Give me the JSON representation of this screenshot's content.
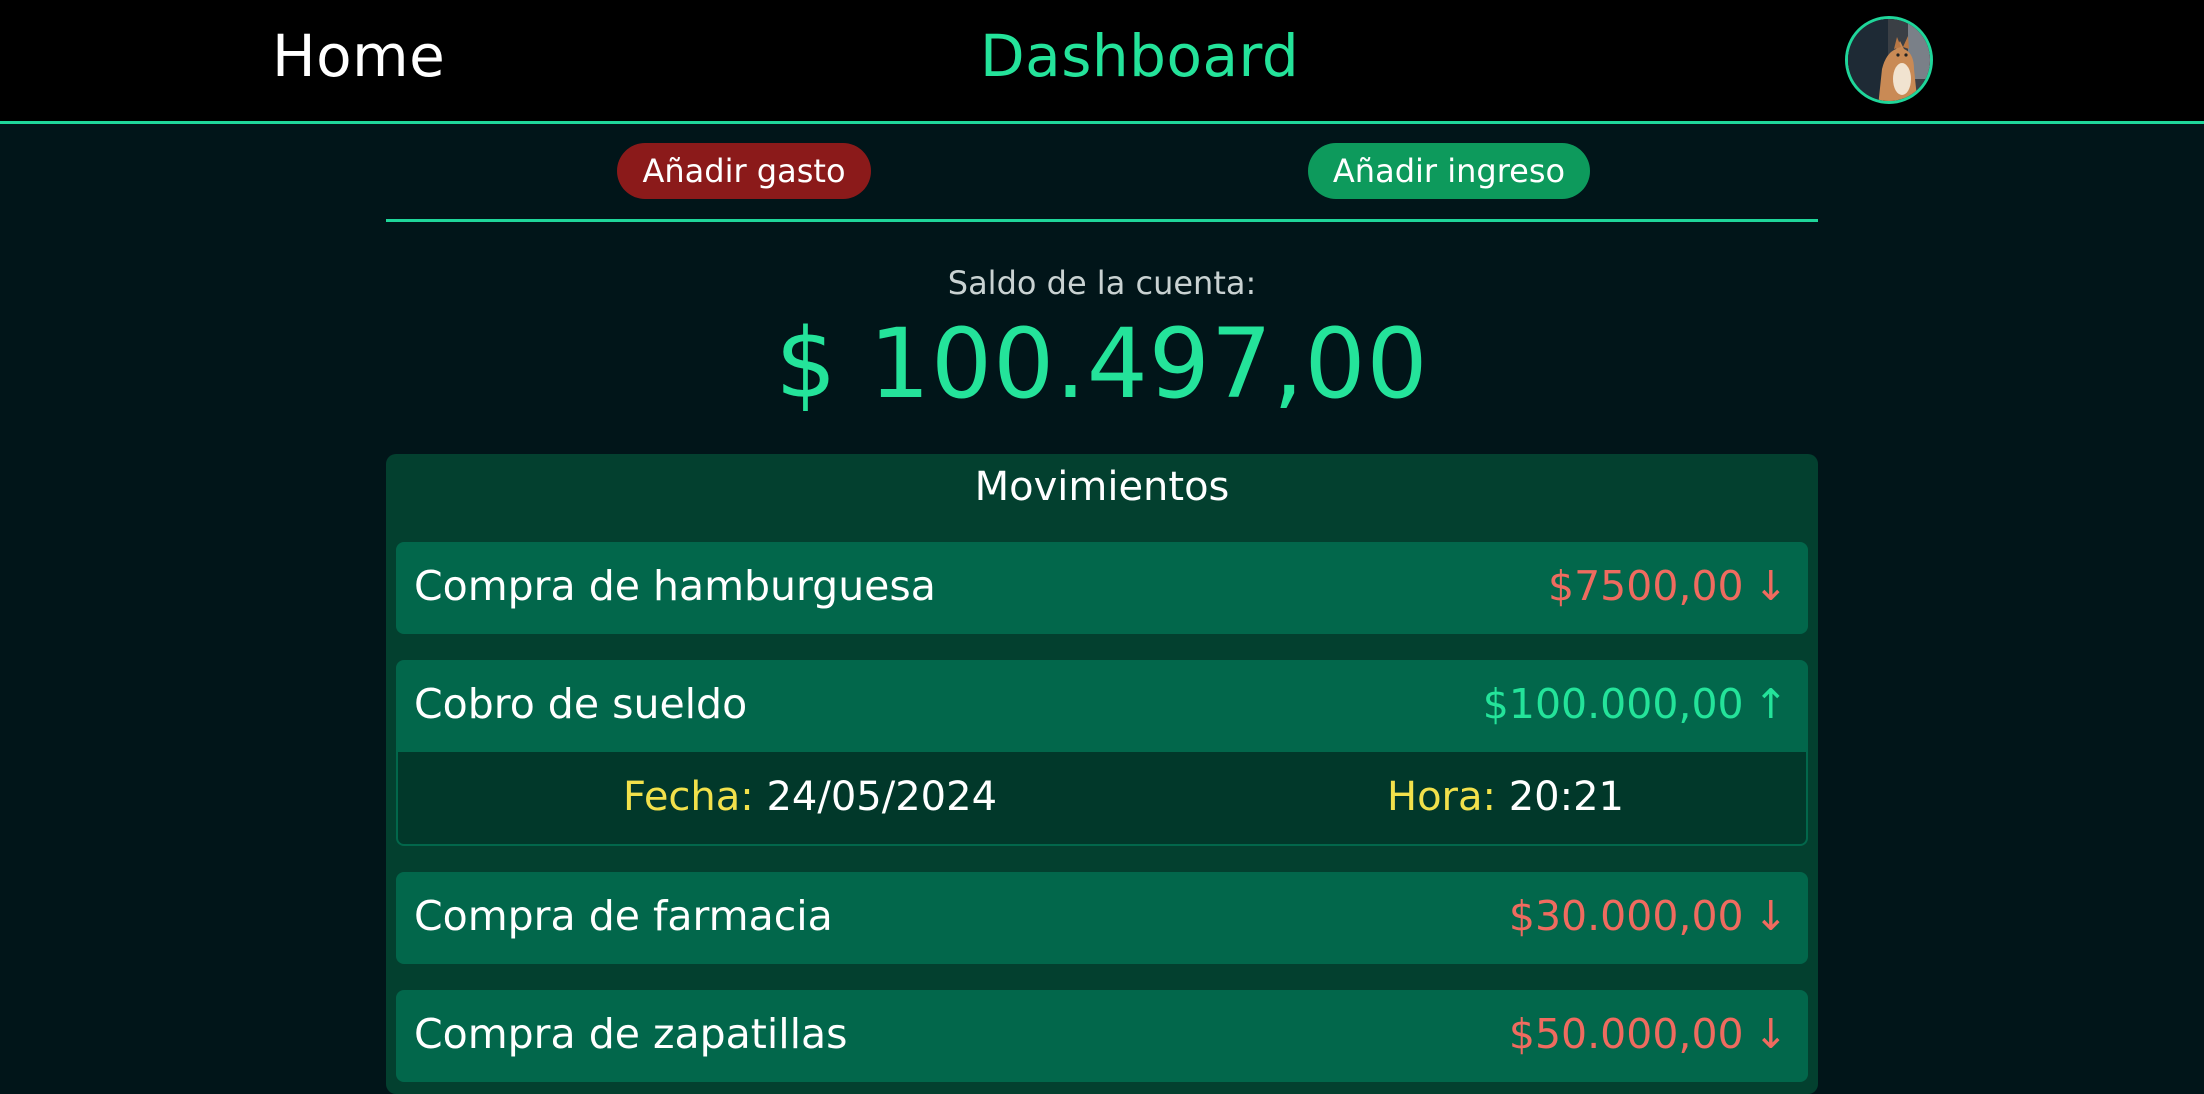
{
  "nav": {
    "home_label": "Home",
    "dashboard_label": "Dashboard"
  },
  "actions": {
    "add_expense_label": "Añadir gasto",
    "add_income_label": "Añadir ingreso"
  },
  "balance": {
    "label": "Saldo de la cuenta:",
    "value": "$ 100.497,00"
  },
  "movements": {
    "title": "Movimientos",
    "items": [
      {
        "name": "Compra de hamburguesa",
        "amount": "$7500,00",
        "direction": "down"
      },
      {
        "name": "Cobro de sueldo",
        "amount": "$100.000,00",
        "direction": "up",
        "expanded": true,
        "date_label": "Fecha:",
        "date": "24/05/2024",
        "time_label": "Hora:",
        "time": "20:21"
      },
      {
        "name": "Compra de farmacia",
        "amount": "$30.000,00",
        "direction": "down"
      },
      {
        "name": "Compra de zapatillas",
        "amount": "$50.000,00",
        "direction": "down"
      }
    ]
  },
  "colors": {
    "accent": "#24e39a",
    "expense": "#ef6b5f",
    "expense_button": "#8b1a1a",
    "income_button": "#0d9a5c",
    "detail_label": "#f2e14b",
    "background": "#011519"
  },
  "icons": {
    "down": "arrow-down-icon",
    "up": "arrow-up-icon"
  }
}
